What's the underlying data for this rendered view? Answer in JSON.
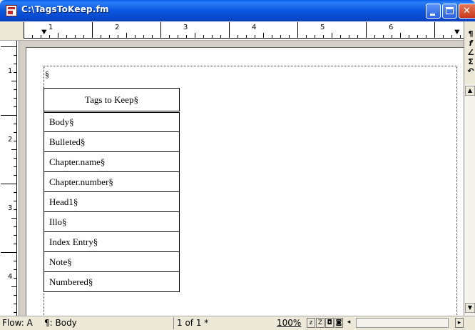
{
  "window": {
    "title": "C:\\TagsToKeep.fm"
  },
  "ruler": {
    "h_numbers": [
      "1",
      "2",
      "3",
      "4",
      "5",
      "6"
    ],
    "v_numbers": [
      "1",
      "2",
      "3",
      "4"
    ]
  },
  "document": {
    "anchor_symbol": "§",
    "table": {
      "header": "Tags to Keep§",
      "rows": [
        "Body§",
        "Bulleted§",
        "Chapter.name§",
        "Chapter.number§",
        "Head1§",
        "Illo§",
        "Index Entry§",
        "Note§",
        "Numbered§"
      ]
    }
  },
  "tools": {
    "items": [
      "¶",
      "f",
      "∠",
      "Σ",
      "↶"
    ]
  },
  "status": {
    "flow": "Flow: A",
    "para_tag": "¶: Body",
    "page": "1 of 1 *",
    "zoom": "100%",
    "z_small": "z",
    "z_large": "Z"
  }
}
